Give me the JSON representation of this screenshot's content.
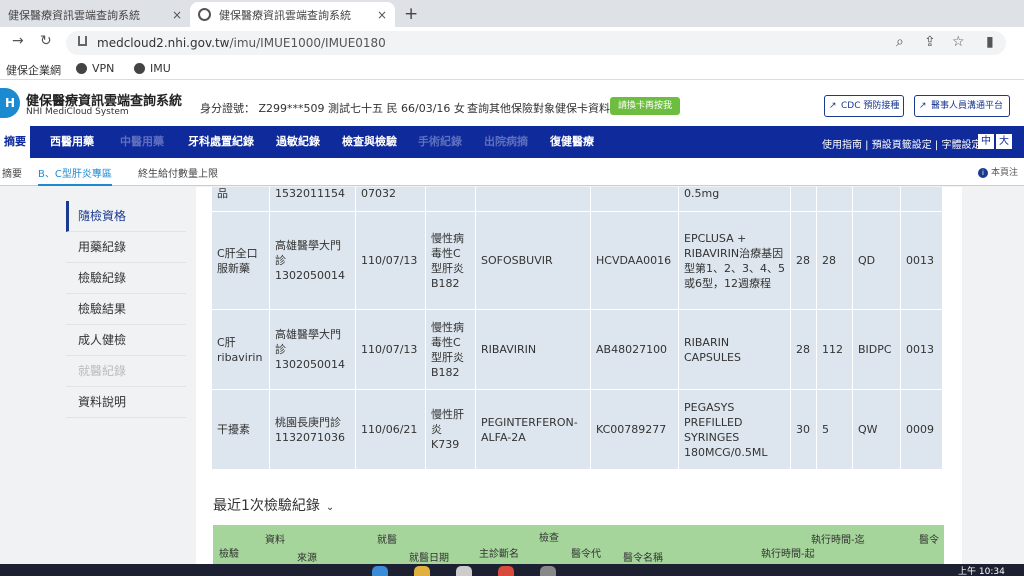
{
  "browser": {
    "tabs": [
      {
        "label": "健保醫療資訊雲端查詢系統",
        "close": "×"
      },
      {
        "label": "健保醫療資訊雲端查詢系統",
        "close": "×"
      }
    ],
    "new_tab": "+",
    "url_host": "medcloud2.nhi.gov.tw",
    "url_path": "/imu/IMUE1000/IMUE0180",
    "bookmarks": [
      "健保企業網",
      "VPN",
      "IMU"
    ]
  },
  "site": {
    "title": "健保醫療資訊雲端查詢系統",
    "subtitle": "NHI MediCloud System",
    "patient": "身分證號： Z299***509  測試七十五  民 66/03/16  女",
    "other_query": "查詢其他保險對象健保卡資料：",
    "switch_card": "請換卡再按我",
    "cdc_button": "CDC 預防接種",
    "medical_staff_button": "醫事人員溝通平台"
  },
  "mainnav": {
    "items": [
      {
        "label": "摘要",
        "state": "active"
      },
      {
        "label": "西醫用藥",
        "state": "normal"
      },
      {
        "label": "中醫用藥",
        "state": "disabled"
      },
      {
        "label": "牙科處置紀錄",
        "state": "normal"
      },
      {
        "label": "過敏紀錄",
        "state": "normal"
      },
      {
        "label": "檢查與檢驗",
        "state": "normal"
      },
      {
        "label": "手術紀錄",
        "state": "disabled"
      },
      {
        "label": "出院病摘",
        "state": "disabled"
      },
      {
        "label": "復健醫療",
        "state": "normal"
      }
    ],
    "right": "使用指南 | 預設頁籤設定 | 字體設定",
    "font_medium": "中大",
    "font_large": "大"
  },
  "subnav": {
    "tabs": [
      "摘要",
      "B、C型肝炎專區",
      "終生給付數量上限"
    ],
    "notice": "本頁注"
  },
  "sidemenu": [
    {
      "label": "隨檢資格",
      "state": "active"
    },
    {
      "label": "用藥紀錄",
      "state": "normal"
    },
    {
      "label": "檢驗紀錄",
      "state": "normal"
    },
    {
      "label": "檢驗結果",
      "state": "normal"
    },
    {
      "label": "成人健檢",
      "state": "normal"
    },
    {
      "label": "就醫紀錄",
      "state": "disabled"
    },
    {
      "label": "資料說明",
      "state": "normal"
    }
  ],
  "med_table": {
    "rows": [
      [
        "品",
        "1532011154",
        "07032",
        "",
        "",
        "",
        "0.5mg",
        "",
        "",
        "",
        ""
      ],
      [
        "C肝全口服新藥",
        "高雄醫學大門診 1302050014",
        "110/07/13",
        "慢性病毒性C型肝炎 B182",
        "SOFOSBUVIR",
        "HCVDAA0016",
        "EPCLUSA + RIBAVIRIN治療基因型第1、2、3、4、5或6型，12週療程",
        "28",
        "28",
        "QD",
        "0013"
      ],
      [
        "C肝 ribavirin",
        "高雄醫學大門診 1302050014",
        "110/07/13",
        "慢性病毒性C型肝炎 B182",
        "RIBAVIRIN",
        "AB48027100",
        "RIBARIN CAPSULES",
        "28",
        "112",
        "BIDPC",
        "0013"
      ],
      [
        "干擾素",
        "桃園長庚門診 1132071036",
        "110/06/21",
        "慢性肝炎 K739",
        "PEGINTERFERON-ALFA-2A",
        "KC00789277",
        "PEGASYS PREFILLED SYRINGES 180MCG/0.5ML",
        "30",
        "5",
        "QW",
        "0009"
      ]
    ]
  },
  "lab_section": {
    "title": "最近1次檢驗紀錄",
    "headers": [
      "檢驗",
      "資料",
      "來源",
      "就醫",
      "就醫日期",
      "主診斷名",
      "檢查",
      "醫令代",
      "醫令名稱",
      "執行時間-起",
      "執行時間-迄",
      "醫令"
    ]
  },
  "taskbar": {
    "time": "上午 10:34"
  }
}
